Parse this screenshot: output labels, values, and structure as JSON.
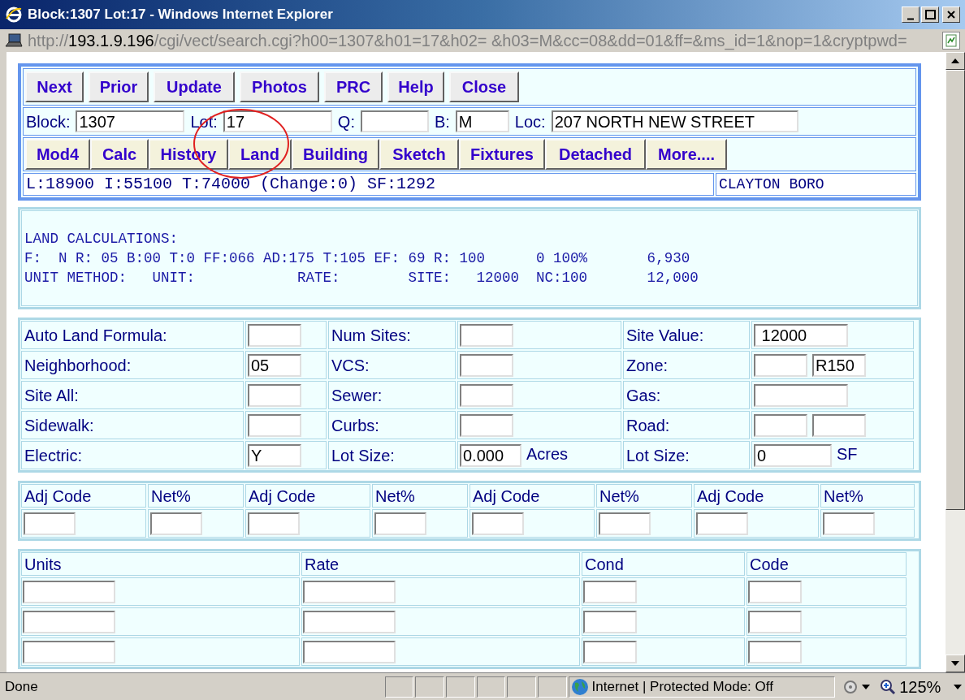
{
  "window": {
    "title": "Block:1307 Lot:17 - Windows Internet Explorer"
  },
  "address_bar": {
    "scheme": "http://",
    "host": "193.1.9.196",
    "path": "/cgi/vect/search.cgi?h00=1307&h01=17&h02= &h03=M&cc=08&dd=01&ff=&ms_id=1&nop=1&cryptpwd="
  },
  "nav_buttons": [
    "Next",
    "Prior",
    "Update",
    "Photos",
    "PRC",
    "Help",
    "Close"
  ],
  "fields": [
    {
      "label": "Block:",
      "value": "1307",
      "kind": "wide"
    },
    {
      "label": "Lot:",
      "value": "17",
      "kind": "wide"
    },
    {
      "label": "Q:",
      "kind": "medium"
    },
    {
      "label": "B:",
      "value": "M",
      "kind": "small"
    },
    {
      "label": "Loc:",
      "value": "207 NORTH NEW STREET",
      "kind": "long"
    }
  ],
  "section_buttons": [
    "Mod4",
    "Calc",
    "History",
    "Land",
    "Building",
    "Sketch",
    "Fixtures",
    "Detached",
    "More...."
  ],
  "summary": {
    "values": "L:18900 I:55100 T:74000 (Change:0) SF:1292",
    "municipality": "CLAYTON BORO"
  },
  "land_calculations": [
    "LAND CALCULATIONS:",
    "F:  N R: 05 B:00 T:0 FF:066 AD:175 T:105 EF: 69 R: 100      0 100%       6,930",
    "UNIT METHOD:   UNIT:            RATE:        SITE:   12000  NC:100       12,000"
  ],
  "land_form": [
    [
      {
        "label": "Auto Land Formula:"
      },
      {
        "label": "Num Sites:"
      },
      {
        "label": "Site Value:",
        "value": " 12000"
      }
    ],
    [
      {
        "label": "Neighborhood:",
        "value": "05"
      },
      {
        "label": "VCS:"
      },
      {
        "label": "Zone:",
        "kind": "double",
        "value_2": "R150"
      }
    ],
    [
      {
        "label": "Site All:"
      },
      {
        "label": "Sewer:"
      },
      {
        "label": "Gas:"
      }
    ],
    [
      {
        "label": "Sidewalk:"
      },
      {
        "label": "Curbs:"
      },
      {
        "label": "Road:",
        "kind": "double"
      }
    ],
    [
      {
        "label": "Electric:",
        "value": "Y"
      },
      {
        "label": "Lot Size:",
        "value": "0.000",
        "unit": "Acres"
      },
      {
        "label": "Lot Size:",
        "value": "0",
        "unit": "SF"
      }
    ]
  ],
  "adjustments": {
    "columns": [
      "Adj Code",
      "Net%",
      "Adj Code",
      "Net%",
      "Adj Code",
      "Net%",
      "Adj Code",
      "Net%"
    ]
  },
  "units_table": {
    "columns": [
      "Units",
      "Rate",
      "Cond",
      "Code"
    ]
  },
  "status_bar": {
    "text": "Done",
    "zone": "Internet | Protected Mode: Off",
    "zoom": "125%"
  }
}
